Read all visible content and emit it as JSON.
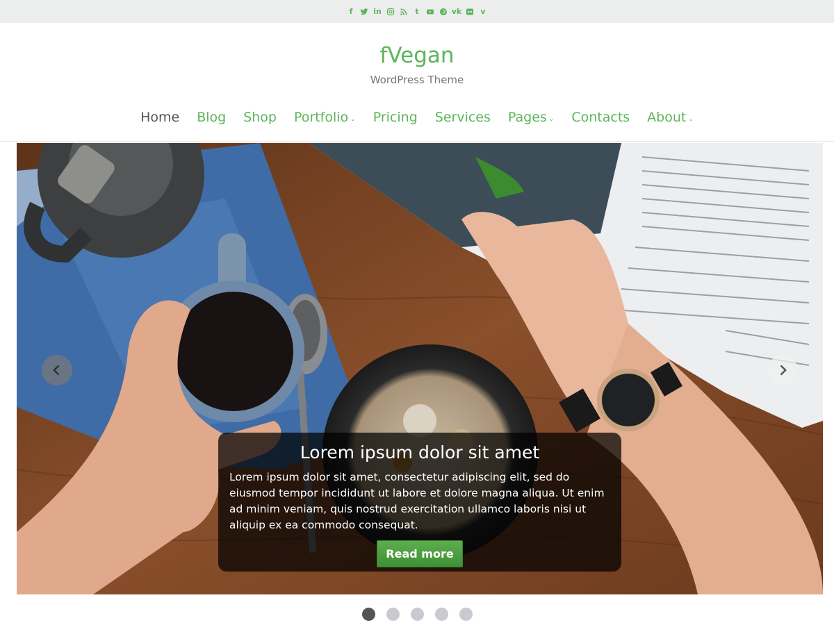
{
  "social": [
    {
      "name": "facebook-icon",
      "glyph": "f"
    },
    {
      "name": "twitter-icon",
      "glyph": ""
    },
    {
      "name": "linkedin-icon",
      "glyph": "in"
    },
    {
      "name": "instagram-icon",
      "glyph": ""
    },
    {
      "name": "rss-icon",
      "glyph": ""
    },
    {
      "name": "tumblr-icon",
      "glyph": "t"
    },
    {
      "name": "youtube-icon",
      "glyph": ""
    },
    {
      "name": "pinterest-icon",
      "glyph": ""
    },
    {
      "name": "vk-icon",
      "glyph": "vk"
    },
    {
      "name": "flickr-icon",
      "glyph": ""
    },
    {
      "name": "vine-icon",
      "glyph": "v"
    }
  ],
  "header": {
    "title": "fVegan",
    "description": "WordPress Theme"
  },
  "nav": {
    "items": [
      {
        "label": "Home",
        "active": true,
        "dropdown": false
      },
      {
        "label": "Blog",
        "active": false,
        "dropdown": false
      },
      {
        "label": "Shop",
        "active": false,
        "dropdown": false
      },
      {
        "label": "Portfolio",
        "active": false,
        "dropdown": true
      },
      {
        "label": "Pricing",
        "active": false,
        "dropdown": false
      },
      {
        "label": "Services",
        "active": false,
        "dropdown": false
      },
      {
        "label": "Pages",
        "active": false,
        "dropdown": true
      },
      {
        "label": "Contacts",
        "active": false,
        "dropdown": false
      },
      {
        "label": "About",
        "active": false,
        "dropdown": true
      }
    ],
    "caret": "⌄"
  },
  "slider": {
    "caption_title": "Lorem ipsum dolor sit amet",
    "caption_text": "Lorem ipsum dolor sit amet, consectetur adipiscing elit, sed do eiusmod tempor incididunt ut labore et dolore magna aliqua. Ut enim ad minim veniam, quis nostrud exercitation ullamco laboris nisi ut aliquip ex ea commodo consequat.",
    "button_label": "Read more",
    "slide_count": 5,
    "active_slide": 1
  },
  "colors": {
    "accent": "#5cb55a",
    "topbar_bg": "#eceeed",
    "nav_active": "#555555",
    "button": "#4e9f41"
  }
}
